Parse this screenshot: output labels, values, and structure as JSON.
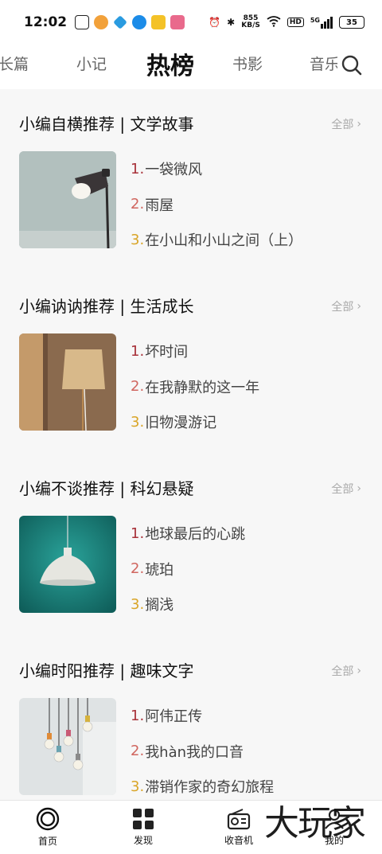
{
  "status_bar": {
    "time": "12:02",
    "speed_top": "855",
    "speed_bottom": "KB/S",
    "hd_badge": "HD",
    "signal": "5G",
    "battery": "35"
  },
  "nav": {
    "tabs": [
      {
        "label": "长篇",
        "active": false
      },
      {
        "label": "小记",
        "active": false
      },
      {
        "label": "热榜",
        "active": true
      },
      {
        "label": "书影",
        "active": false
      },
      {
        "label": "音乐",
        "active": false
      }
    ],
    "search_icon": "search-icon"
  },
  "sections": [
    {
      "title": "小编自横推荐 | 文学故事",
      "see_all": "全部",
      "image": "desk-lamp-gray",
      "items": [
        {
          "num": "1.",
          "title": "一袋微风",
          "color": "#a8323a"
        },
        {
          "num": "2.",
          "title": "雨屋",
          "color": "#d0665f"
        },
        {
          "num": "3.",
          "title": "在小山和小山之间（上）",
          "color": "#d9a528"
        }
      ]
    },
    {
      "title": "小编讷讷推荐 | 生活成长",
      "see_all": "全部",
      "image": "wood-lamp",
      "items": [
        {
          "num": "1.",
          "title": "坏时间",
          "color": "#a8323a"
        },
        {
          "num": "2.",
          "title": "在我静默的这一年",
          "color": "#d0665f"
        },
        {
          "num": "3.",
          "title": "旧物漫游记",
          "color": "#d9a528"
        }
      ]
    },
    {
      "title": "小编不谈推荐 | 科幻悬疑",
      "see_all": "全部",
      "image": "pendant-lamp-teal",
      "items": [
        {
          "num": "1.",
          "title": "地球最后的心跳",
          "color": "#a8323a"
        },
        {
          "num": "2.",
          "title": "琥珀",
          "color": "#d0665f"
        },
        {
          "num": "3.",
          "title": "搁浅",
          "color": "#d9a528"
        }
      ]
    },
    {
      "title": "小编时阳推荐 | 趣味文字",
      "see_all": "全部",
      "image": "hanging-bulbs",
      "items": [
        {
          "num": "1.",
          "title": "阿伟正传",
          "color": "#a8323a"
        },
        {
          "num": "2.",
          "title": "我hàn我的口音",
          "color": "#d0665f"
        },
        {
          "num": "3.",
          "title": "滞销作家的奇幻旅程",
          "color": "#d9a528"
        }
      ]
    }
  ],
  "bottom_nav": [
    {
      "label": "首页",
      "icon": "home-ring-icon"
    },
    {
      "label": "发现",
      "icon": "grid-icon"
    },
    {
      "label": "收音机",
      "icon": "radio-icon"
    },
    {
      "label": "我的",
      "icon": "profile-icon"
    }
  ],
  "watermark": "大玩家"
}
